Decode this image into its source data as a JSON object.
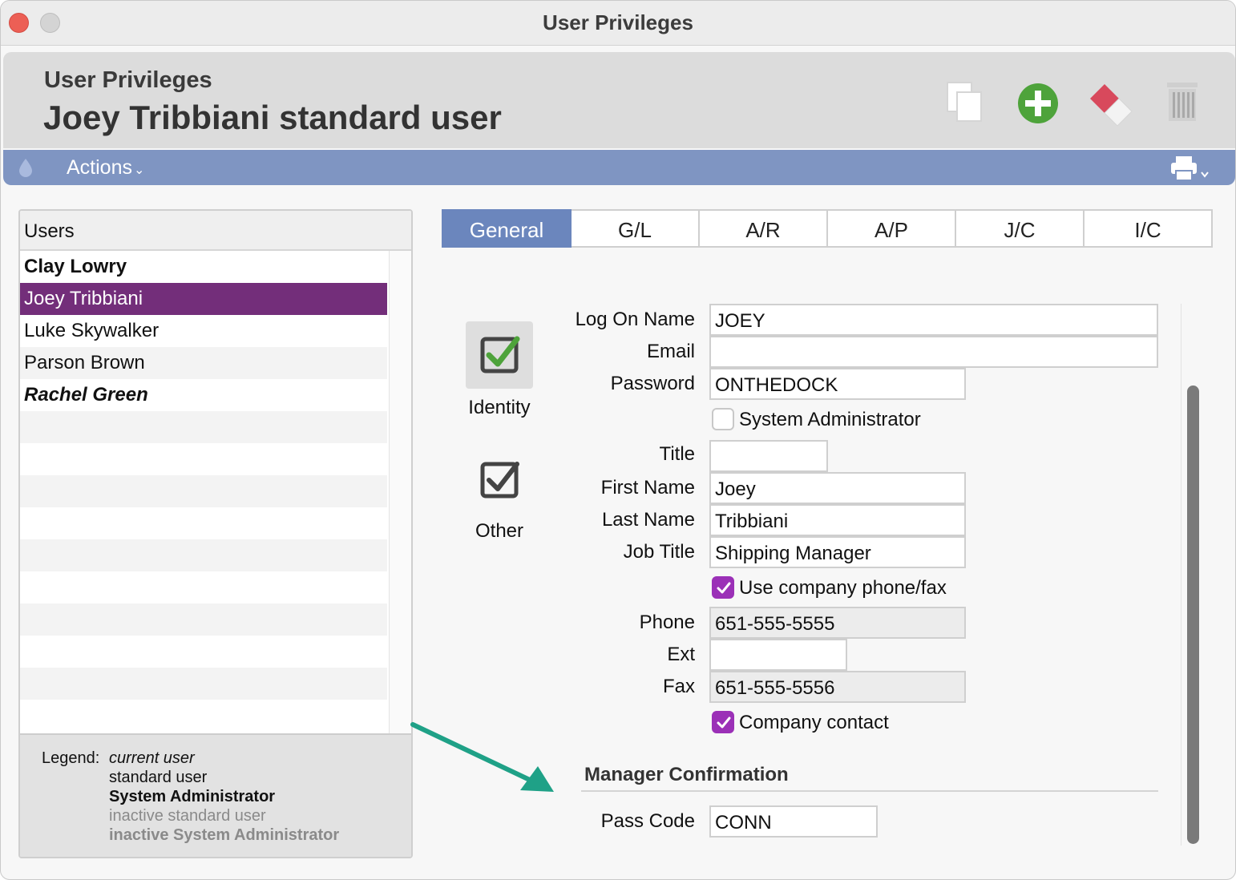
{
  "window": {
    "title": "User Privileges"
  },
  "header": {
    "subtitle": "User Privileges",
    "title": "Joey Tribbiani standard user"
  },
  "toolbar": {
    "actions_label": "Actions"
  },
  "icons": {
    "copy": "copy-icon",
    "add": "add-icon",
    "eraser": "eraser-icon",
    "trash": "trash-icon",
    "drop": "drop-icon",
    "print": "print-icon"
  },
  "colors": {
    "accent": "#7f95c2",
    "selected_row": "#732e7a",
    "active_tab": "#6b86bd",
    "checkbox": "#9b30b7",
    "add_green": "#4ea33b",
    "arrow": "#1fa187"
  },
  "users": {
    "header": "Users",
    "items": [
      {
        "name": "Clay Lowry",
        "kind": "sysadmin"
      },
      {
        "name": "Joey Tribbiani",
        "kind": "selected"
      },
      {
        "name": "Luke Skywalker",
        "kind": "standard"
      },
      {
        "name": "Parson Brown",
        "kind": "standard"
      },
      {
        "name": "Rachel Green",
        "kind": "current-sysadmin"
      }
    ],
    "legend": {
      "label": "Legend:",
      "current": "current user",
      "standard": "standard user",
      "sysadmin": "System Administrator",
      "inactive_standard": "inactive standard user",
      "inactive_sysadmin": "inactive System Administrator"
    }
  },
  "tabs": [
    {
      "label": "General",
      "active": true
    },
    {
      "label": "G/L",
      "active": false
    },
    {
      "label": "A/R",
      "active": false
    },
    {
      "label": "A/P",
      "active": false
    },
    {
      "label": "J/C",
      "active": false
    },
    {
      "label": "I/C",
      "active": false
    }
  ],
  "sidebar": {
    "identity": "Identity",
    "other": "Other"
  },
  "form": {
    "logon_label": "Log On Name",
    "logon_value": "JOEY",
    "email_label": "Email",
    "email_value": "",
    "password_label": "Password",
    "password_value": "ONTHEDOCK",
    "sysadmin_label": "System Administrator",
    "sysadmin_checked": false,
    "title_label": "Title",
    "title_value": "",
    "first_label": "First Name",
    "first_value": "Joey",
    "last_label": "Last Name",
    "last_value": "Tribbiani",
    "job_label": "Job Title",
    "job_value": "Shipping Manager",
    "use_company_label": "Use company phone/fax",
    "use_company_checked": true,
    "phone_label": "Phone",
    "phone_value": "651-555-5555",
    "ext_label": "Ext",
    "ext_value": "",
    "fax_label": "Fax",
    "fax_value": "651-555-5556",
    "company_contact_label": "Company contact",
    "company_contact_checked": true,
    "manager_section": "Manager Confirmation",
    "passcode_label": "Pass Code",
    "passcode_value": "CONN"
  }
}
